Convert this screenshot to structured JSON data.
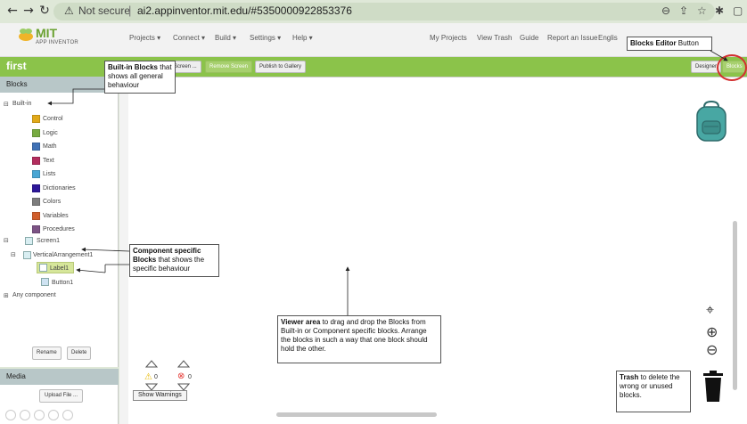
{
  "browser": {
    "security_label": "Not secure",
    "url": "ai2.appinventor.mit.edu/#5350000922853376"
  },
  "header": {
    "logo_title": "MIT",
    "logo_subtitle": "APP INVENTOR",
    "menus": [
      "Projects ▾",
      "Connect ▾",
      "Build ▾",
      "Settings ▾",
      "Help ▾"
    ],
    "links": [
      "My Projects",
      "View Trash",
      "Guide",
      "Report an Issue",
      "Englis"
    ]
  },
  "project_bar": {
    "project_name": "first",
    "screen_button": "Screen ...",
    "remove_screen_button": "Remove Screen",
    "publish_button": "Publish to Gallery",
    "designer_button": "Designer",
    "blocks_button": "Blocks"
  },
  "palette": {
    "header": "Blocks",
    "builtin_label": "Built-in",
    "builtin_items": [
      {
        "label": "Control",
        "color": "#e1a91a"
      },
      {
        "label": "Logic",
        "color": "#77ab41"
      },
      {
        "label": "Math",
        "color": "#3f71b5"
      },
      {
        "label": "Text",
        "color": "#b32d5e"
      },
      {
        "label": "Lists",
        "color": "#49a6d4"
      },
      {
        "label": "Dictionaries",
        "color": "#2d1799"
      },
      {
        "label": "Colors",
        "color": "#7d7d7d"
      },
      {
        "label": "Variables",
        "color": "#d05f2d"
      },
      {
        "label": "Procedures",
        "color": "#7c5385"
      }
    ],
    "screen_label": "Screen1",
    "arrangement_label": "VerticalArrangement1",
    "label1": "Label1",
    "button1": "Button1",
    "any_component_label": "Any component",
    "rename_button": "Rename",
    "delete_button": "Delete"
  },
  "media": {
    "header": "Media",
    "upload_button": "Upload File ..."
  },
  "workspace": {
    "warning_count": "0",
    "error_count": "0",
    "show_warnings_button": "Show Warnings"
  },
  "annotations": {
    "blocks_editor_bold": "Blocks Editor",
    "blocks_editor_rest": " Button",
    "builtin_bold": "Built-in Blocks",
    "builtin_rest": " that shows all general behaviour",
    "component_bold": "Component specific Blocks",
    "component_rest": " that shows the specific behaviour",
    "viewer_bold": "Viewer area",
    "viewer_rest": " to drag and drop the Blocks from Built-in or Component specific blocks. Arrange the blocks in such a way that one block should hold the other.",
    "trash_bold": "Trash",
    "trash_rest": " to delete the wrong or unused blocks."
  },
  "colors": {
    "accent_green": "#8bc34a",
    "highlight_red": "#d32f2f"
  }
}
